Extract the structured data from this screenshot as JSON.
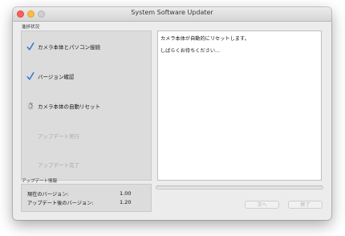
{
  "window": {
    "title": "System Software Updater"
  },
  "progress": {
    "heading": "進捗状況",
    "steps": [
      {
        "label": "カメラ本体とパソコン接続",
        "state": "done"
      },
      {
        "label": "バージョン確認",
        "state": "done"
      },
      {
        "label": "カメラ本体の自動リセット",
        "state": "active"
      },
      {
        "label": "アップデート実行",
        "state": "pending"
      },
      {
        "label": "アップデート完了",
        "state": "pending"
      }
    ]
  },
  "log": {
    "lines": [
      "カメラ本体が自動的にリセットします。",
      "しばらくお待ちください..."
    ]
  },
  "update_info": {
    "heading": "アップデート情報",
    "current_version_label": "現在のバージョン:",
    "current_version": "1.00",
    "new_version_label": "アップデート後のバージョン:",
    "new_version": "1.20"
  },
  "progress_bar": {
    "value_percent": 0
  },
  "buttons": {
    "next": "次へ",
    "finish": "終了"
  },
  "colors": {
    "check": "#3b73d1",
    "pending_text": "#a9a9a9",
    "close": "#fc605b",
    "minimize": "#fdbc40"
  }
}
